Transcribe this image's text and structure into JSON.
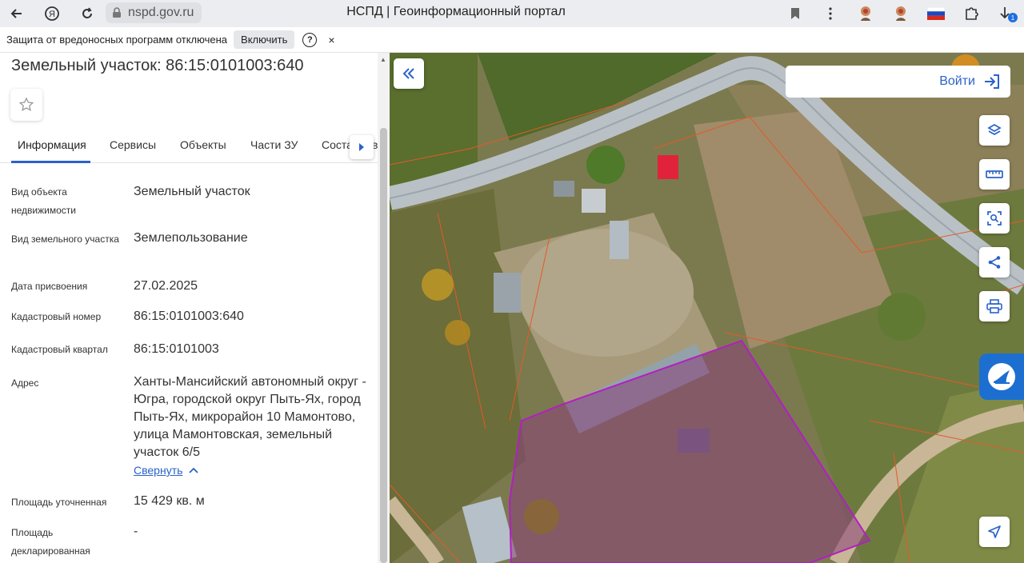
{
  "browser": {
    "url": "nspd.gov.ru",
    "title": "НСПД | Геоинформационный портал",
    "notification_badge": "1"
  },
  "warning": {
    "text": "Защита от вредоносных программ отключена",
    "enable_label": "Включить",
    "help_label": "?",
    "close_label": "×"
  },
  "panel": {
    "title": "Земельный участок: 86:15:0101003:640",
    "tabs": [
      "Информация",
      "Сервисы",
      "Объекты",
      "Части ЗУ",
      "Соста"
    ],
    "tab_overflow": "в",
    "rows": [
      {
        "label": "Вид объекта недвижимости",
        "value": "Земельный участок"
      },
      {
        "label": "Вид земельного участка",
        "value": "Землепользование"
      },
      {
        "label": "Дата присвоения",
        "value": "27.02.2025"
      },
      {
        "label": "Кадастровый номер",
        "value": "86:15:0101003:640"
      },
      {
        "label": "Кадастровый квартал",
        "value": "86:15:0101003"
      },
      {
        "label": "Адрес",
        "value": "Ханты-Мансийский автономный округ - Югра, городской округ Пыть-Ях, город Пыть-Ях, микрорайон 10 Мамонтово, улица Мамонтовская, земельный участок 6/5"
      },
      {
        "label": "Площадь уточненная",
        "value": "15 429 кв. м"
      },
      {
        "label": "Площадь декларированная",
        "value": "-"
      }
    ],
    "collapse_link": "Свернуть"
  },
  "map": {
    "login_label": "Войти",
    "tools": [
      "layers-icon",
      "ruler-icon",
      "area-select-icon",
      "share-icon",
      "print-icon"
    ],
    "accent": "#2a62c9",
    "parcel_outline_color": "#b21fc4"
  }
}
